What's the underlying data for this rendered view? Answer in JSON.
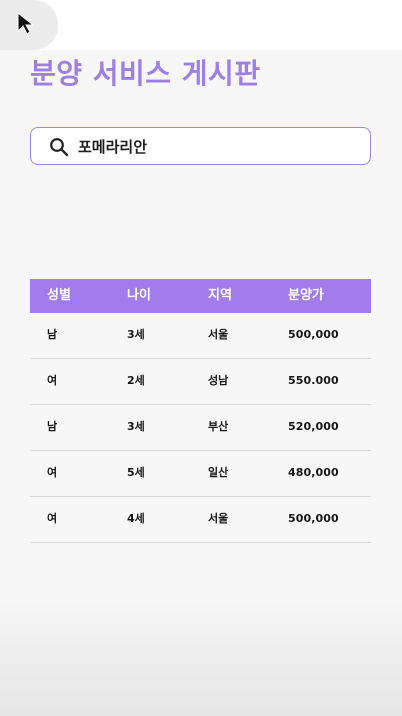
{
  "app": {
    "title": "분양 서비스 게시판"
  },
  "search": {
    "value": "포메라리안",
    "placeholder": ""
  },
  "table": {
    "headers": [
      "성별",
      "나이",
      "지역",
      "분양가"
    ],
    "rows": [
      [
        "남",
        "3세",
        "서울",
        "500,000"
      ],
      [
        "여",
        "2세",
        "성남",
        "550.000"
      ],
      [
        "남",
        "3세",
        "부산",
        "520,000"
      ],
      [
        "여",
        "5세",
        "일산",
        "480,000"
      ],
      [
        "여",
        "4세",
        "서울",
        "500,000"
      ]
    ]
  },
  "colors": {
    "accent": "#a27ceb",
    "title": "#9d7fe6",
    "search_border": "#9d87db",
    "background": "#f7f7f8"
  },
  "icons": {
    "cursor": "cursor-icon",
    "search": "search-icon"
  }
}
